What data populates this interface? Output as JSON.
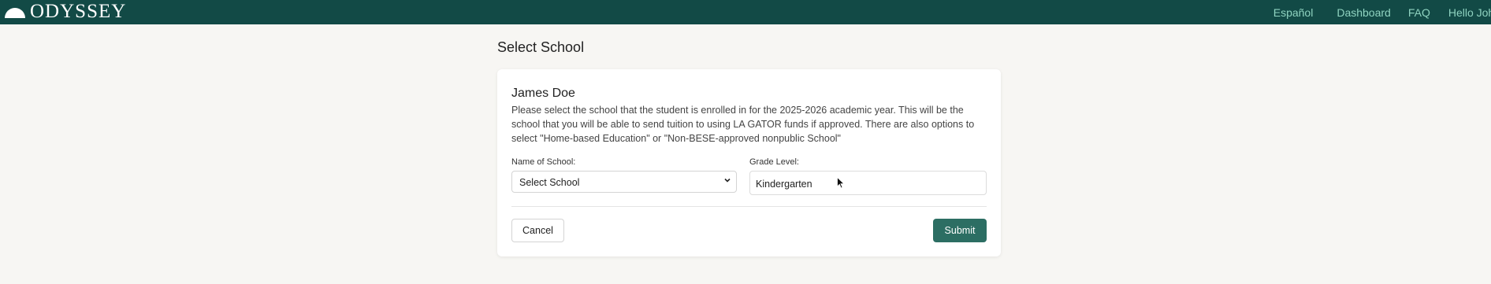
{
  "header": {
    "logo_text": "ODYSSEY",
    "nav": {
      "espanol": "Español",
      "dashboard": "Dashboard",
      "faq": "FAQ",
      "hello": "Hello John"
    }
  },
  "page": {
    "title": "Select School"
  },
  "form": {
    "student_name": "James Doe",
    "instructions": "Please select the school that the student is enrolled in for the 2025-2026 academic year. This will be the school that you will be able to send tuition to using LA GATOR funds if approved. There are also options to select \"Home-based Education\" or \"Non-BESE-approved nonpublic School\"",
    "school_label": "Name of School:",
    "school_value": "Select School",
    "grade_label": "Grade Level:",
    "grade_value": "Kindergarten",
    "cancel_label": "Cancel",
    "submit_label": "Submit"
  },
  "colors": {
    "header_bg": "#124a46",
    "nav_link": "#8fd3c0",
    "primary_button": "#2c6e63"
  }
}
